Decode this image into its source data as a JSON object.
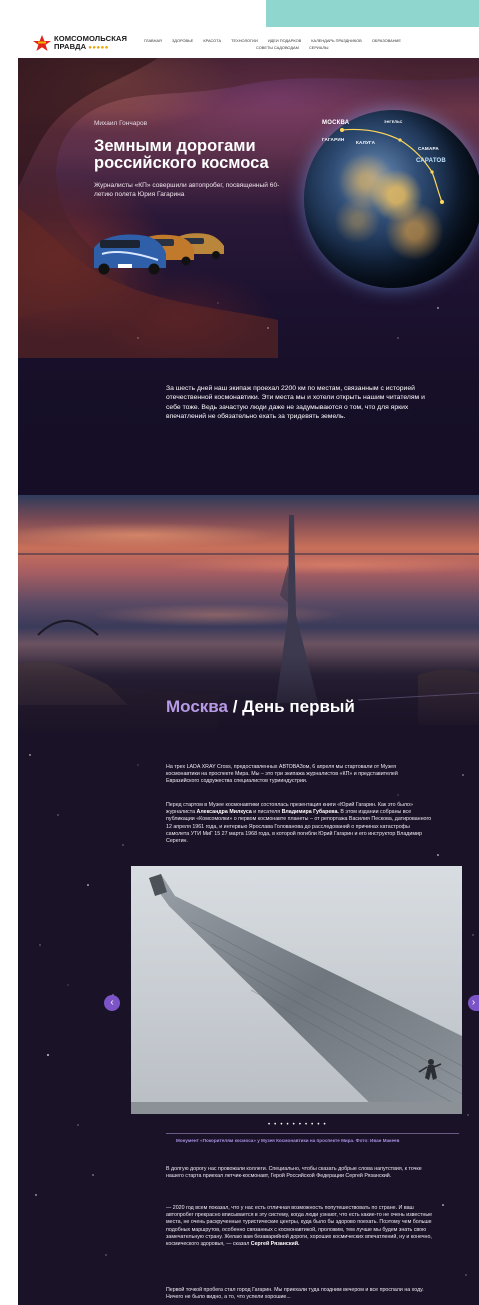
{
  "header": {
    "logo_line1": "КОМСОМОЛЬСКАЯ",
    "logo_line2": "ПРАВДА",
    "nav_row1": [
      "ГЛАВНАЯ",
      "ЗДОРОВЬЕ",
      "КРАСОТА",
      "ТЕХНОЛОГИИ",
      "ИДЕИ ПОДАРКОВ",
      "КАЛЕНДАРЬ ПРАЗДНИКОВ",
      "ОБРАЗОВАНИЕ"
    ],
    "nav_row2": [
      "СОВЕТЫ САДОВОДАМ",
      "СЕРИАЛЫ"
    ]
  },
  "hero": {
    "author": "Михаил Гончаров",
    "title": "Земными дорогами российского космоса",
    "subtitle": "Журналисты «КП» совершили автопробег, посвященный 60-летию полета Юрия Гагарина",
    "map_labels": [
      "МОСКВА",
      "ГАГАРИН",
      "КАЛУГА",
      "САМАРА",
      "САРАТОВ",
      "ЭНГЕЛЬС"
    ],
    "intro": "За шесть дней наш экипаж проехал 2200 км по местам, связанным с историей отечественной космонавтики. Эти места мы и хотели открыть нашим читателям и себе тоже. Ведь зачастую люди даже не задумываются о том, что для ярких впечатлений не обязательно ехать за тридевять земель."
  },
  "section": {
    "city": "Москва",
    "separator": " / ",
    "day": "День первый"
  },
  "article": {
    "p1": "На трех LADA XRAY Cross, предоставленных АВТОВАЗом, 6 апреля мы стартовали от Музея космонавтики на проспекте Мира. Мы – это три экипажа журналистов «КП» и представителей Евразийского содружества специалистов турииндустрии.",
    "p2_a": "Перед стартом в Музее космонавтики состоялась презентация книги «Юрий Гагарин. Как это было» журналиста ",
    "p2_b1": "Александра Милкуса",
    "p2_c": " и писателя ",
    "p2_b2": "Владимира Губарева.",
    "p2_d": " В этом издании собраны все публикации «Комсомолки» о первом космонавте планеты – от репортажа Василия Пескова, датированного 12 апреля 1961 года, и интервью Ярослава Голованова до расследований о причинах катастрофы самолета УТИ МиГ 15 27 марта 1968 года, в которой погибли Юрий Гагарин и его инструктор Владимир Серегин.",
    "p3": "В долгую дорогу нас провожали коллеги. Специально, чтобы сказать добрые слова напутствия, к точке нашего старта приехал летчик-космонавт, Герой Российской Федерации Сергей Рязанский.",
    "p4_a": "— 2020 год всем показал, что у нас есть отличная возможность попутешествовать по стране. И ваш автопробег прекрасно вписывается в эту систему, когда люди узнают, что есть какие-то не очень известные места, не очень раскрученные туристические центры, куда было бы здорово поехать. Поэтому чем больше подобных маршрутов, особенно связанных с космонавтикой, проложим, тем лучше мы будем знать свою замечательную страну. Желаю вам безаварийной дороги, хороших космических впечатлений, ну и конечно, космического здоровья, — сказал ",
    "p4_b": "Сергей Рязанский.",
    "p5": "Первой точкой пробега стал город Гагарин. Мы приехали туда поздним вечером и все проспали на ходу. Ничего не было видно, а то, что успели хорошие..."
  },
  "slider": {
    "prev": "‹",
    "next": "›",
    "dots": "• • • • • • • • • •",
    "caption": "Монумент «Покорителям космоса» у Музея Космонавтики на проспекте Мира. Фото: Иван Макеев"
  },
  "colors": {
    "accent": "#7b55c7",
    "city_title": "#b79ae6",
    "caption": "#a68ee0",
    "teal": "#8fd6cf",
    "background_space": "#1a1226"
  }
}
